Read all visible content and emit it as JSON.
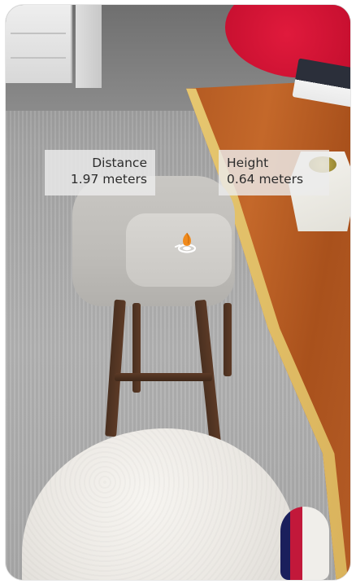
{
  "distance_label": {
    "title": "Distance",
    "value": "1.97 meters"
  },
  "height_label": {
    "title": "Height",
    "value": "0.64 meters"
  },
  "colors": {
    "label_background": "#ebebeb",
    "label_text": "#2c2c2c",
    "anchor_orange": "#f08a1c"
  },
  "icons": {
    "anchor": "ar-anchor-pin-icon"
  }
}
